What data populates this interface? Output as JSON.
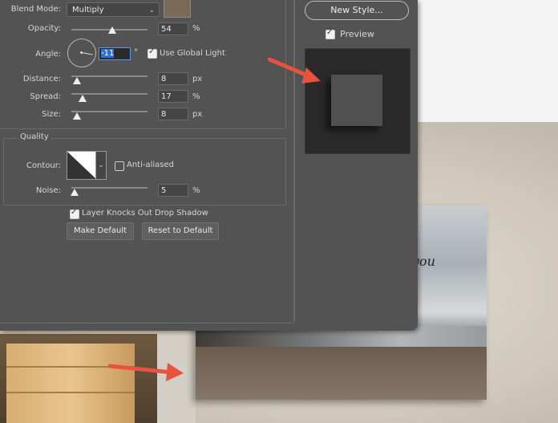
{
  "structure": {
    "blend_mode_label": "Blend Mode:",
    "blend_mode_value": "Multiply",
    "shadow_color": "#7a6a56",
    "opacity_label": "Opacity:",
    "opacity_value": "54",
    "opacity_unit": "%",
    "angle_label": "Angle:",
    "angle_value": "-11",
    "angle_unit": "°",
    "use_global_light_label": "Use Global Light",
    "use_global_light_checked": true,
    "distance_label": "Distance:",
    "distance_value": "8",
    "distance_unit": "px",
    "spread_label": "Spread:",
    "spread_value": "17",
    "spread_unit": "%",
    "size_label": "Size:",
    "size_value": "8",
    "size_unit": "px"
  },
  "quality": {
    "title": "Quality",
    "contour_label": "Contour:",
    "anti_aliased_label": "Anti-aliased",
    "anti_aliased_checked": false,
    "noise_label": "Noise:",
    "noise_value": "5",
    "noise_unit": "%"
  },
  "layer_knocks_out_label": "Layer Knocks Out Drop Shadow",
  "layer_knocks_out_checked": true,
  "make_default_label": "Make Default",
  "reset_default_label": "Reset to Default",
  "new_style_label": "New Style...",
  "preview_label": "Preview",
  "preview_checked": true,
  "photo_text": "you",
  "colors": {
    "dialog_bg": "#535353",
    "arrow": "#e8533f"
  },
  "icons": [
    "chevron-down-icon",
    "check-icon",
    "red-arrow-icon"
  ]
}
